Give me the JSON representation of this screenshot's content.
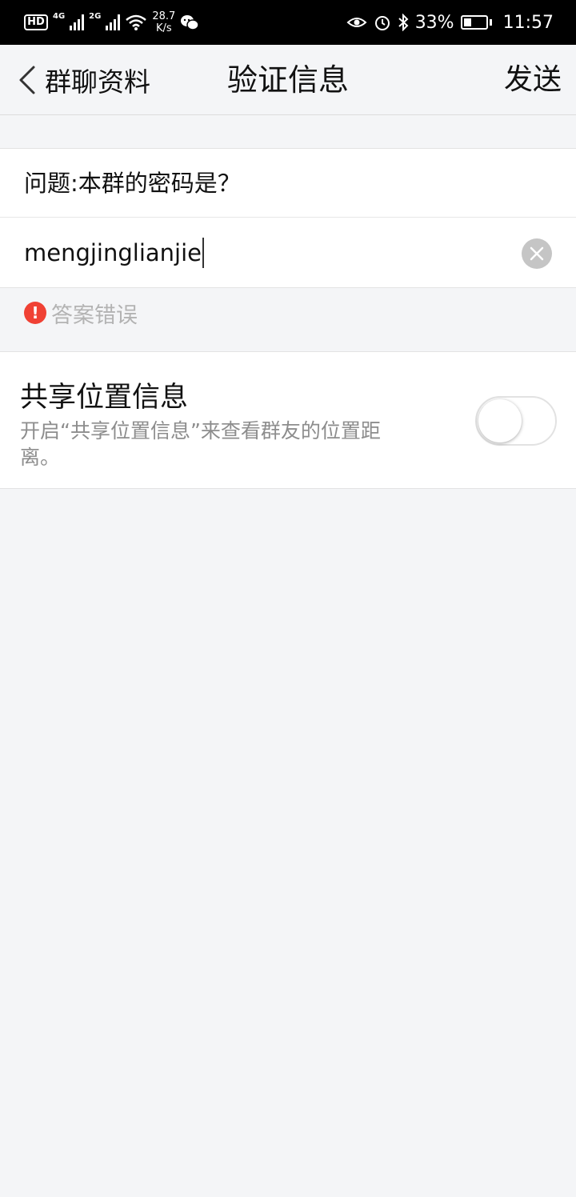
{
  "status_bar": {
    "hd": "HD",
    "net1": "4G",
    "net2": "2G",
    "speed_value": "28.7",
    "speed_unit": "K/s",
    "battery_pct": "33%",
    "battery_level": 0.33,
    "time": "11:57"
  },
  "nav": {
    "back_label": "群聊资料",
    "title": "验证信息",
    "send_label": "发送"
  },
  "form": {
    "question": "问题:本群的密码是？",
    "answer_value": "mengjinglianjie",
    "error_mark": "!",
    "error_text": "答案错误"
  },
  "share_location": {
    "title": "共享位置信息",
    "description": "开启“共享位置信息”来查看群友的位置距离。",
    "enabled": false
  },
  "colors": {
    "error": "#f04134",
    "hint_gray": "#8d8d8d",
    "background": "#f4f5f7"
  }
}
